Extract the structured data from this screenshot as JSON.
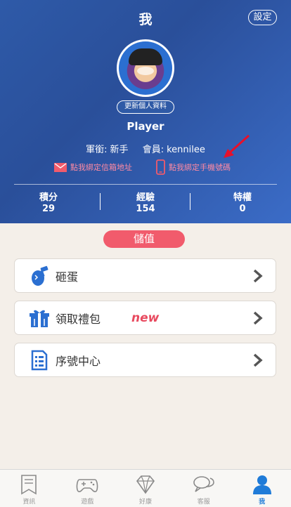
{
  "header": {
    "title": "我",
    "settings_label": "設定",
    "update_profile_label": "更新個人資料",
    "player_name": "Player",
    "rank_label": "軍銜:",
    "rank_value": "新手",
    "member_label": "會員:",
    "member_value": "kennilee",
    "bind_email_label": "點我綁定信箱地址",
    "bind_phone_label": "點我綁定手機號碼",
    "stats": [
      {
        "label": "積分",
        "value": "29"
      },
      {
        "label": "經驗",
        "value": "154"
      },
      {
        "label": "特權",
        "value": "0"
      }
    ]
  },
  "main": {
    "store_label": "儲值",
    "menu": [
      {
        "label": "砸蛋",
        "icon": "egg-hammer-icon"
      },
      {
        "label": "領取禮包",
        "badge": "new",
        "icon": "gift-icon"
      },
      {
        "label": "序號中心",
        "icon": "serial-list-icon"
      }
    ]
  },
  "tabbar": {
    "tabs": [
      {
        "label": "資訊",
        "icon": "bookmark-icon",
        "active": false
      },
      {
        "label": "遊戲",
        "icon": "gamepad-icon",
        "active": false
      },
      {
        "label": "好康",
        "icon": "diamond-icon",
        "active": false
      },
      {
        "label": "客服",
        "icon": "chat-icon",
        "active": false
      },
      {
        "label": "我",
        "icon": "person-icon",
        "active": true
      }
    ]
  },
  "colors": {
    "header_blue": "#2e5aa8",
    "accent_red": "#f15b6c",
    "bind_pink": "#ff8aa3",
    "tab_active": "#1f7bd8",
    "icon_blue": "#2b6fd1"
  }
}
